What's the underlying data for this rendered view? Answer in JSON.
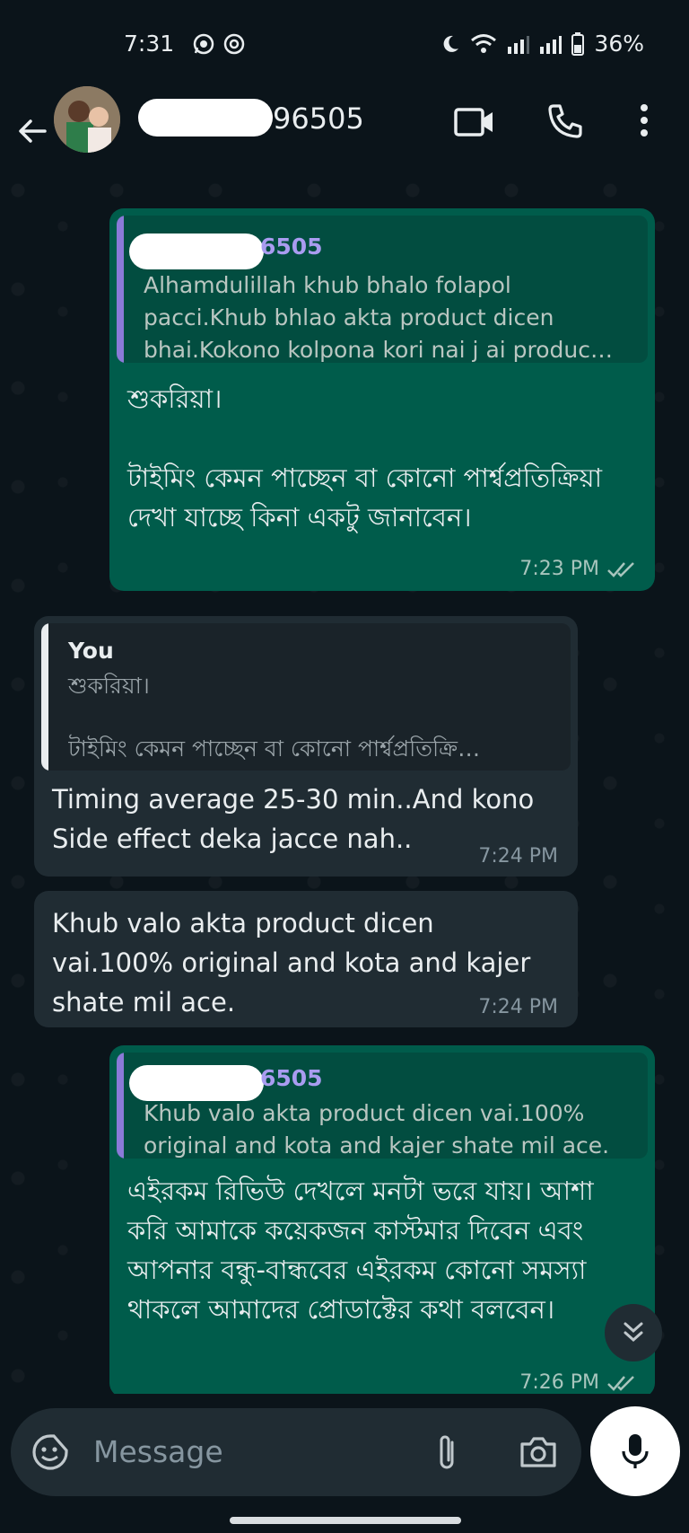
{
  "status_bar": {
    "time": "7:31",
    "battery": "36%"
  },
  "header": {
    "contact_name_visible": "96505"
  },
  "messages": [
    {
      "quote_name": "6505",
      "quote_text": "Alhamdulillah khub bhalo folapol pacci.Khub bhlao akta product dicen bhai.Kokono kolpona kori nai j ai produc…",
      "body": "শুকরিয়া।\n\nটাইমিং কেমন পাচ্ছেন বা কোনো পার্শ্বপ্রতিক্রিয়া দেখা যাচ্ছে কিনা একটু জানাবেন।",
      "time": "7:23 PM"
    },
    {
      "quote_name": "You",
      "quote_line1": "শুকরিয়া।",
      "quote_line2": "টাইমিং কেমন পাচ্ছেন বা কোনো পার্শ্বপ্রতিক্রি…",
      "body": "Timing average 25-30 min..And kono Side effect deka jacce nah..",
      "time": "7:24 PM"
    },
    {
      "body": "Khub valo akta product dicen vai.100% original and kota and kajer shate mil ace.",
      "time": "7:24 PM"
    },
    {
      "quote_name": "6505",
      "quote_text": "Khub valo akta product dicen vai.100% original and kota and kajer shate mil ace.",
      "body": "এইরকম রিভিউ দেখলে মনটা ভরে যায়। আশা করি আমাকে কয়েকজন কাস্টমার দিবেন এবং আপনার বন্ধু-বান্ধবের এইরকম কোনো সমস্যা থাকলে আমাদের প্রোডাক্টের কথা বলবেন।",
      "time": "7:26 PM"
    }
  ],
  "input": {
    "placeholder": "Message"
  },
  "colors": {
    "background": "#0b141a",
    "outgoing_bubble": "#005c4b",
    "incoming_bubble": "#202c33",
    "quote_bar_out": "#8a7ad8",
    "quote_name_you": "#e9edef",
    "read_ticks": "#a8c5bd"
  }
}
